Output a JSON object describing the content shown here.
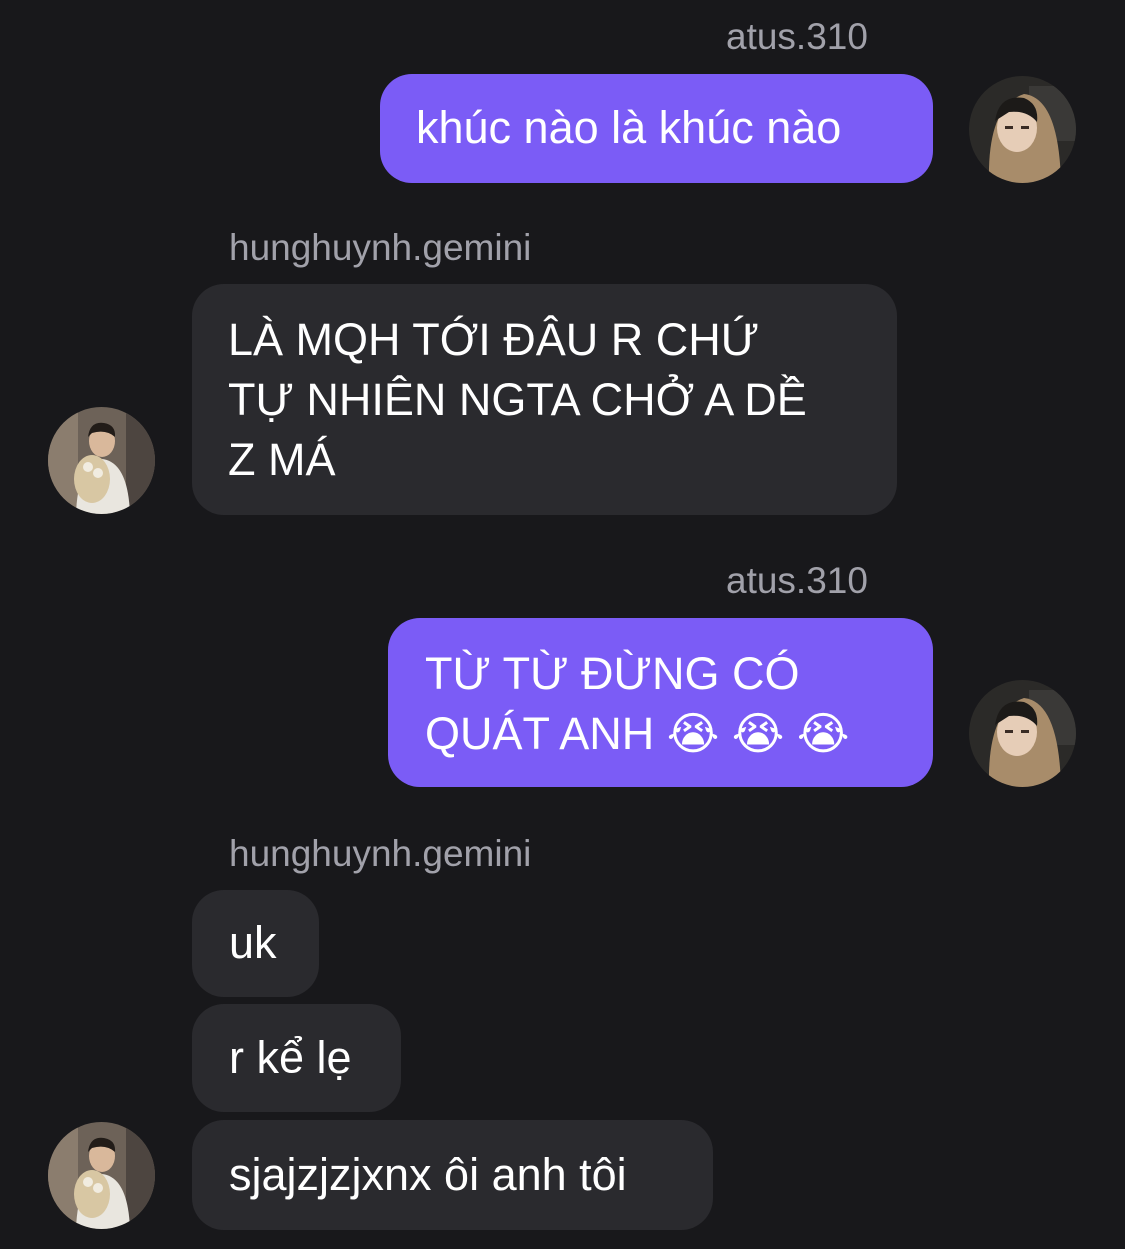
{
  "users": {
    "me": {
      "handle": "atus.310"
    },
    "other": {
      "handle": "hunghuynh.gemini"
    }
  },
  "messages": [
    {
      "text": "khúc nào là khúc nào"
    },
    {
      "text": "LÀ MQH TỚI ĐÂU R CHỨ\nTỰ NHIÊN NGTA CHỞ A DỀ\nZ MÁ"
    },
    {
      "text": "TỪ TỪ ĐỪNG CÓ\nQUÁT ANH 😭 😭 😭"
    },
    {
      "text": "uk"
    },
    {
      "text": "r kể lẹ"
    },
    {
      "text": "sjajzjzjxnx ôi anh tôi"
    }
  ],
  "colors": {
    "background": "#18181b",
    "outgoing_bubble": "#7b5cf6",
    "incoming_bubble": "#2a2a2e",
    "sender_text": "#a1a1aa"
  }
}
